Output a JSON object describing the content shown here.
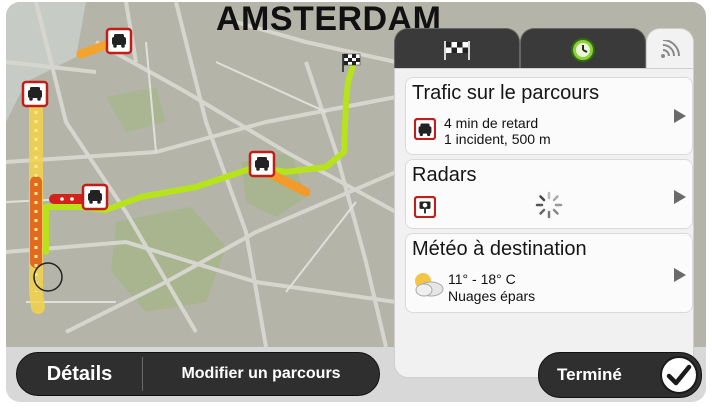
{
  "map": {
    "city_label": "AMSTERDAM"
  },
  "panel": {
    "tabs": [
      {
        "name": "flag-tab",
        "icon": "checkered-flag-icon",
        "active": false
      },
      {
        "name": "clock-tab",
        "icon": "clock-icon",
        "active": false
      },
      {
        "name": "live-tab",
        "icon": "signal-icon",
        "active": true
      }
    ],
    "traffic": {
      "title": "Trafic sur le parcours",
      "delay": "4 min de retard",
      "incidents": "1 incident, 500 m"
    },
    "radars": {
      "title": "Radars"
    },
    "weather": {
      "title": "Météo à destination",
      "temp": "11° - 18° C",
      "condition": "Nuages épars"
    }
  },
  "bottom_bar": {
    "details_label": "Détails",
    "modify_label": "Modifier un parcours",
    "done_label": "Terminé"
  },
  "colors": {
    "route_green": "#b7e31a",
    "traffic_red": "#d2221b",
    "traffic_orange": "#f3a42f",
    "panel_dark": "#3a3a3a",
    "map_background": "#b5b6aa"
  }
}
